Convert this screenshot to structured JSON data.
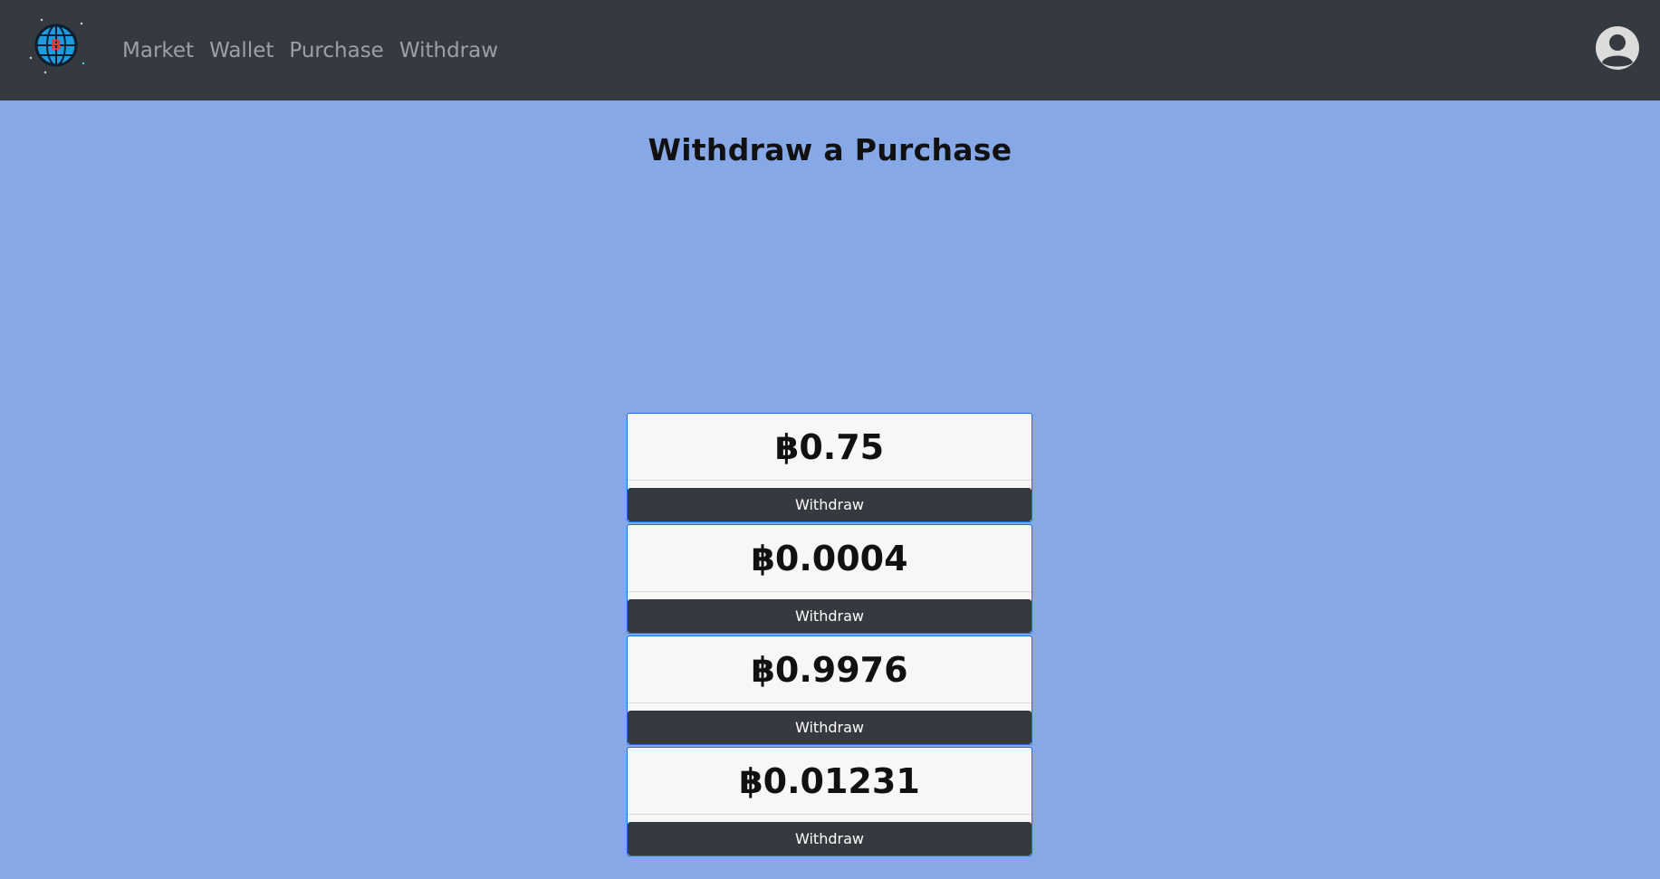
{
  "nav": {
    "logo_icon": "bitcoin-globe-logo-icon",
    "links": [
      {
        "label": "Market"
      },
      {
        "label": "Wallet"
      },
      {
        "label": "Purchase"
      },
      {
        "label": "Withdraw"
      }
    ],
    "avatar_icon": "user-avatar-icon"
  },
  "page": {
    "title": "Withdraw a Purchase"
  },
  "purchases": [
    {
      "amount": "฿0.75",
      "button_label": "Withdraw"
    },
    {
      "amount": "฿0.0004",
      "button_label": "Withdraw"
    },
    {
      "amount": "฿0.9976",
      "button_label": "Withdraw"
    },
    {
      "amount": "฿0.01231",
      "button_label": "Withdraw"
    }
  ],
  "colors": {
    "navbar": "#343a40",
    "background": "#86a8e7",
    "card_border": "#1b6fe0",
    "button": "#343a40"
  }
}
